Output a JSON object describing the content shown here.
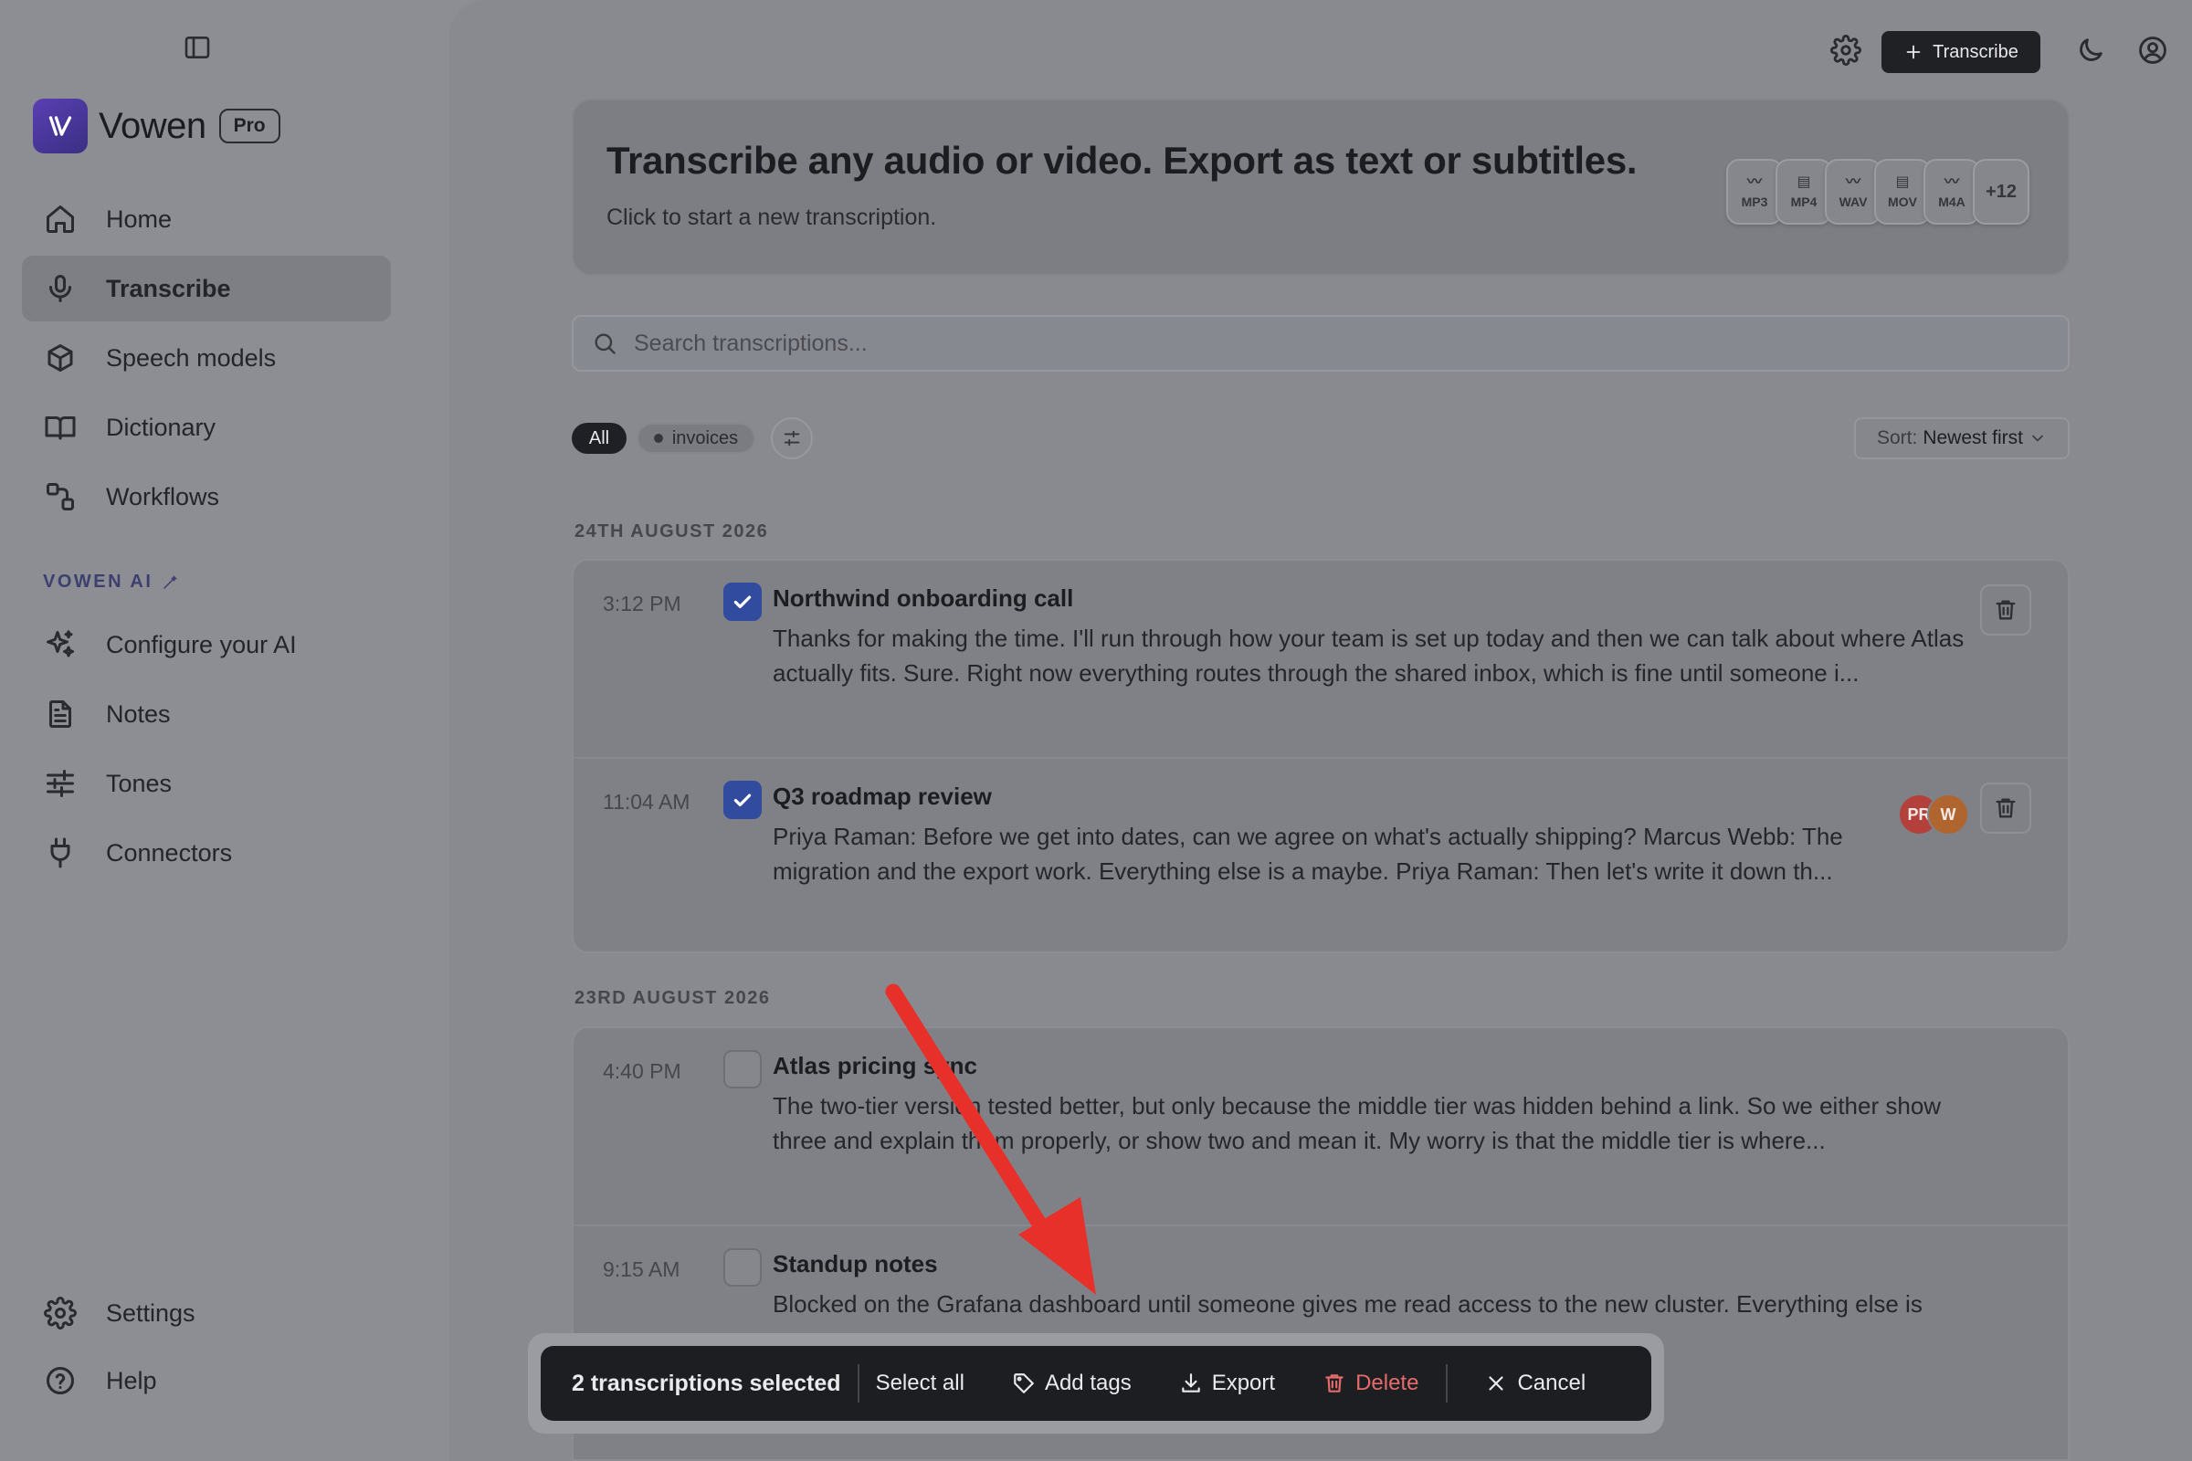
{
  "app": {
    "name": "Vowen",
    "plan_badge": "Pro"
  },
  "sidebar": {
    "items": [
      {
        "label": "Home",
        "icon": "home-icon"
      },
      {
        "label": "Transcribe",
        "icon": "mic-icon",
        "active": true
      },
      {
        "label": "Speech models",
        "icon": "box-icon"
      },
      {
        "label": "Dictionary",
        "icon": "book-icon"
      },
      {
        "label": "Workflows",
        "icon": "workflow-icon"
      }
    ],
    "section_label": "VOWEN AI",
    "ai_items": [
      {
        "label": "Configure your AI",
        "icon": "sparkle-icon"
      },
      {
        "label": "Notes",
        "icon": "file-text-icon"
      },
      {
        "label": "Tones",
        "icon": "sliders-icon"
      },
      {
        "label": "Connectors",
        "icon": "plug-icon"
      }
    ],
    "bottom_items": [
      {
        "label": "Settings",
        "icon": "gear-icon"
      },
      {
        "label": "Help",
        "icon": "help-circle-icon"
      }
    ]
  },
  "topbar": {
    "transcribe_label": "Transcribe"
  },
  "hero": {
    "title": "Transcribe any audio or video. Export as text or subtitles.",
    "subtitle": "Click to start a new transcription.",
    "formats": [
      "MP3",
      "MP4",
      "WAV",
      "MOV",
      "M4A"
    ],
    "more_formats": "+12"
  },
  "search": {
    "placeholder": "Search transcriptions..."
  },
  "filters": {
    "all_label": "All",
    "tag_label": "invoices"
  },
  "sort": {
    "prefix": "Sort:",
    "value": "Newest first"
  },
  "groups": [
    {
      "date": "24TH AUGUST 2026",
      "rows": [
        {
          "time": "3:12 PM",
          "checked": true,
          "title": "Northwind onboarding call",
          "excerpt": "Thanks for making the time. I'll run through how your team is set up today and then we can talk about where Atlas actually fits. Sure. Right now everything routes through the shared inbox, which is fine until someone i..."
        },
        {
          "time": "11:04 AM",
          "checked": true,
          "title": "Q3 roadmap review",
          "excerpt": "Priya Raman: Before we get into dates, can we agree on what's actually shipping? Marcus Webb: The migration and the export work. Everything else is a maybe. Priya Raman: Then let's write it down th...",
          "avatars": [
            {
              "initials": "PR",
              "color": "#b3403a"
            },
            {
              "initials": "W",
              "color": "#b0652e"
            }
          ]
        }
      ]
    },
    {
      "date": "23RD AUGUST 2026",
      "rows": [
        {
          "time": "4:40 PM",
          "checked": false,
          "title": "Atlas pricing sync",
          "excerpt": "The two-tier version tested better, but only because the middle tier was hidden behind a link. So we either show three and explain them properly, or show two and mean it. My worry is that the middle tier is where..."
        },
        {
          "time": "9:15 AM",
          "checked": false,
          "title": "Standup notes",
          "excerpt": "Blocked on the Grafana dashboard until someone gives me read access to the new cluster. Everything else is"
        }
      ]
    }
  ],
  "selection_bar": {
    "count_label": "2 transcriptions selected",
    "select_all": "Select all",
    "add_tags": "Add tags",
    "export": "Export",
    "delete": "Delete",
    "cancel": "Cancel"
  },
  "colors": {
    "accent": "#314b9e",
    "danger": "#e56b6b",
    "annotation_arrow": "#e8302a"
  }
}
